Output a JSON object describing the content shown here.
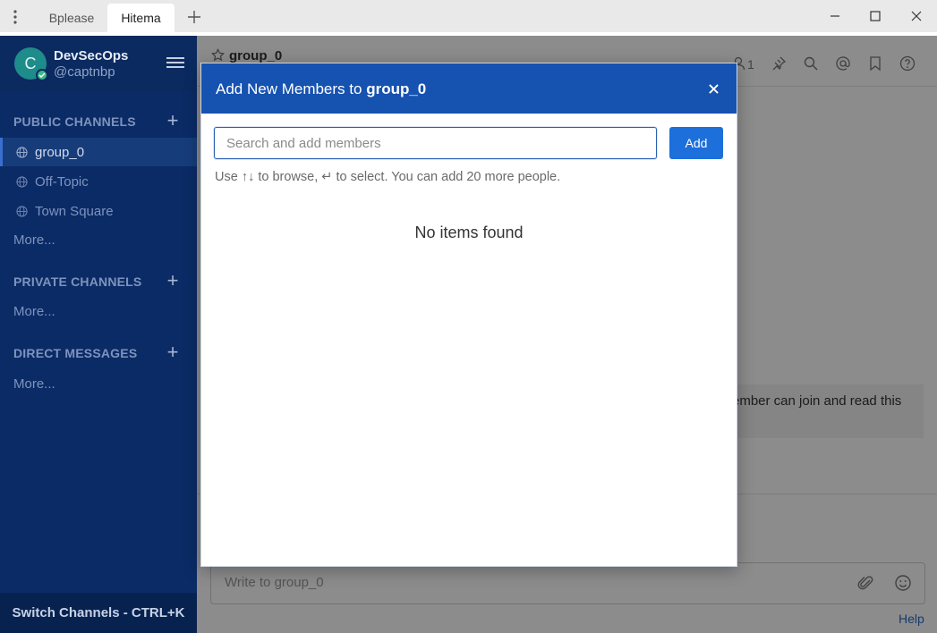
{
  "titlebar": {
    "tabs": [
      {
        "label": "Bplease",
        "active": false
      },
      {
        "label": "Hitema",
        "active": true
      }
    ],
    "menu_icon": "vertical-dots-icon",
    "add_tab_icon": "plus-icon",
    "window_controls": [
      "minimize-icon",
      "maximize-icon",
      "close-icon"
    ]
  },
  "sidebar": {
    "team_initial": "C",
    "team_name": "DevSecOps",
    "user_handle": "@captnbp",
    "sections": {
      "public": {
        "title": "PUBLIC CHANNELS",
        "channels": [
          {
            "label": "group_0",
            "active": true
          },
          {
            "label": "Off-Topic",
            "active": false
          },
          {
            "label": "Town Square",
            "active": false
          }
        ],
        "more": "More..."
      },
      "private": {
        "title": "PRIVATE CHANNELS",
        "more": "More..."
      },
      "direct": {
        "title": "DIRECT MESSAGES",
        "more": "More..."
      }
    },
    "switch_channels": "Switch Channels - CTRL+K"
  },
  "channel": {
    "name": "group_0",
    "member_count": "1",
    "intro_fragment": "ember can join and read this",
    "composer_placeholder": "Write to group_0",
    "help": "Help"
  },
  "modal": {
    "title_prefix": "Add New Members to ",
    "title_channel": "group_0",
    "search_placeholder": "Search and add members",
    "add_button": "Add",
    "hint": "Use ↑↓ to browse, ↵ to select. You can add 20 more people.",
    "empty_message": "No items found"
  },
  "colors": {
    "sidebar_bg": "#0b2b66",
    "modal_header": "#1652b0",
    "add_button": "#1d6fdb",
    "online": "#3db887"
  }
}
